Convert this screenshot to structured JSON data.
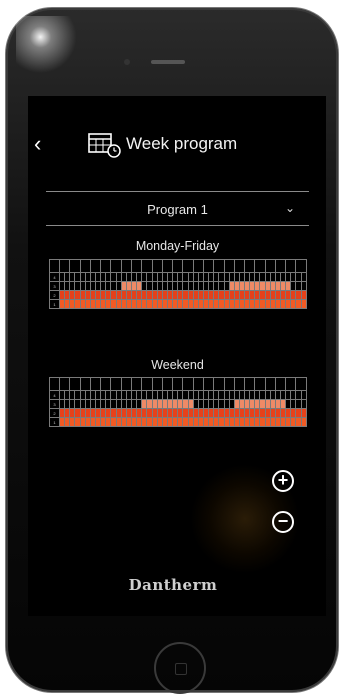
{
  "header": {
    "back_glyph": "‹",
    "title": "Week program",
    "icon": "calendar-clock-icon"
  },
  "program_select": {
    "value": "Program 1",
    "chevron": "⌄"
  },
  "schedules": [
    {
      "title": "Monday-Friday",
      "levels_top_to_bottom": [
        "4",
        "3",
        "2",
        "1"
      ],
      "active_level_per_hour": [
        2,
        2,
        2,
        2,
        2,
        2,
        2,
        2,
        2,
        2,
        2,
        2,
        3,
        3,
        3,
        3,
        2,
        2,
        2,
        2,
        2,
        2,
        2,
        2,
        2,
        2,
        2,
        2,
        2,
        2,
        2,
        2,
        2,
        3,
        3,
        3,
        3,
        3,
        3,
        3,
        3,
        3,
        3,
        3,
        3,
        2,
        2,
        2
      ]
    },
    {
      "title": "Weekend",
      "levels_top_to_bottom": [
        "4",
        "3",
        "2",
        "1"
      ],
      "active_level_per_hour": [
        2,
        2,
        2,
        2,
        2,
        2,
        2,
        2,
        2,
        2,
        2,
        2,
        2,
        2,
        2,
        2,
        3,
        3,
        3,
        3,
        3,
        3,
        3,
        3,
        3,
        3,
        2,
        2,
        2,
        2,
        2,
        2,
        2,
        2,
        3,
        3,
        3,
        3,
        3,
        3,
        3,
        3,
        3,
        3,
        2,
        2,
        2,
        2
      ]
    }
  ],
  "zoom": {
    "in_glyph": "+",
    "out_glyph": "−"
  },
  "brand": "Dantherm",
  "colors": {
    "level3": "#ef8a66",
    "level2": "#e6411a",
    "level1": "#f15a24",
    "background": "#000000"
  }
}
